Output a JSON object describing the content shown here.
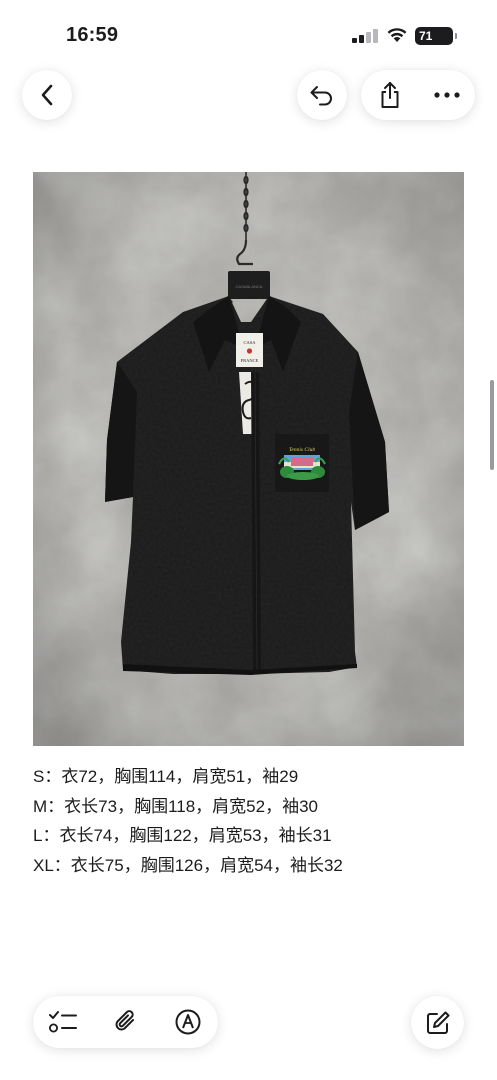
{
  "status_bar": {
    "time": "16:59",
    "battery_level": "71"
  },
  "nav": {
    "back_icon": "chevron-left-icon",
    "undo_icon": "undo-icon",
    "share_icon": "share-icon",
    "more_icon": "ellipsis-icon"
  },
  "photo": {
    "subject": "black short-sleeve shirt on hanger",
    "hanger_tag_text": "CASABLANCA",
    "label_text": "CASA FRANCE"
  },
  "note": {
    "lines": [
      "S：衣72，胸围114，肩宽51，袖29",
      "M：衣长73，胸围118，肩宽52，袖30",
      "L：衣长74，胸围122，肩宽53，袖长31",
      "XL：衣长75，胸围126，肩宽54，袖长32"
    ]
  },
  "toolbar": {
    "checklist_icon": "checklist-icon",
    "attachment_icon": "paperclip-icon",
    "markup_icon": "pen-circle-icon",
    "compose_icon": "compose-icon"
  },
  "colors": {
    "background": "#ffffff",
    "text": "#1c1c1e",
    "shirt": "#1b1b1b",
    "wall": "#a8a7a4"
  }
}
